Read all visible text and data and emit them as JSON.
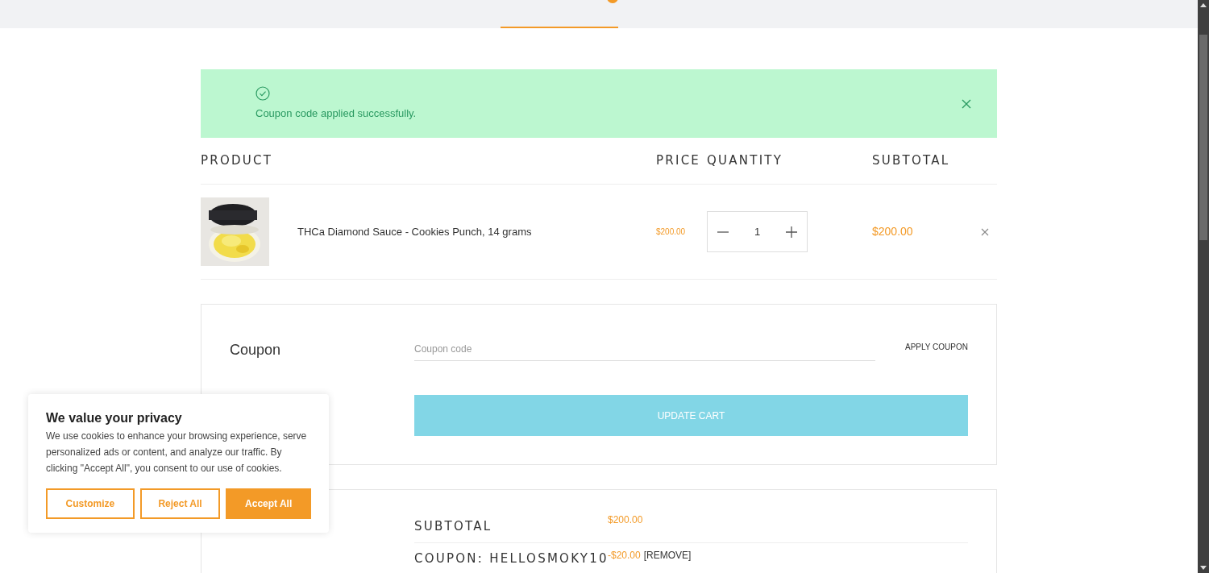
{
  "steps": [
    {
      "selected": true,
      "badge": true
    }
  ],
  "notice": {
    "message": "Coupon code applied successfully."
  },
  "table": {
    "columns": [
      "PRODUCT",
      "PRICE",
      "QUANTITY",
      "SUBTOTAL"
    ],
    "rows": [
      {
        "name": "THCa Diamond Sauce - Cookies Punch, 14 grams",
        "price": "$200.00",
        "quantity": "1",
        "subtotal": "$200.00"
      }
    ]
  },
  "coupon": {
    "title": "Coupon",
    "placeholder": "Coupon code",
    "apply": "APPLY COUPON",
    "update": "UPDATE CART"
  },
  "totals": [
    {
      "label": "SUBTOTAL",
      "value": "$200.00"
    },
    {
      "label": "COUPON: HELLOSMOKY10",
      "value": "-$20.00",
      "action": "[REMOVE]"
    }
  ],
  "cookie_banner": {
    "title": "We value your privacy",
    "text": "We use cookies to enhance your browsing experience, serve personalized ads or content, and analyze our traffic. By clicking \"Accept All\", you consent to our use of cookies.",
    "buttons": [
      {
        "label": "Customize",
        "kind": "outline"
      },
      {
        "label": "Reject All",
        "kind": "outline"
      },
      {
        "label": "Accept All",
        "kind": "filled"
      }
    ]
  }
}
